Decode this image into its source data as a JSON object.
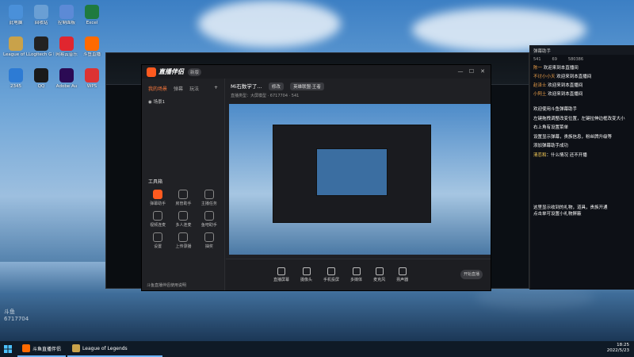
{
  "desktop": {
    "icons": [
      {
        "label": "此电脑",
        "color": "#4a90d9"
      },
      {
        "label": "回收站",
        "color": "#6a9fd4"
      },
      {
        "label": "控制面板",
        "color": "#5c8ad6"
      },
      {
        "label": "Excel",
        "color": "#1f7a3f"
      },
      {
        "label": "League of Legends",
        "color": "#c9a24a"
      },
      {
        "label": "Logitech G HUB",
        "color": "#222"
      },
      {
        "label": "网易云音乐",
        "color": "#e0262f"
      },
      {
        "label": "斗鱼直播",
        "color": "#ff6a00"
      },
      {
        "label": "2345",
        "color": "#2d7bd4"
      },
      {
        "label": "QQ",
        "color": "#1a1a1a"
      },
      {
        "label": "Adobe Au",
        "color": "#2b0a54"
      },
      {
        "label": "WPS",
        "color": "#d33"
      }
    ]
  },
  "live_watermark": {
    "line1": "斗鱼",
    "line2": "6717704"
  },
  "app": {
    "name": "直播伴侣",
    "version_tag": "新版",
    "tabs": [
      "我的场景",
      "弹幕",
      "玩法"
    ],
    "scene": "场景1",
    "tools_title": "工具箱",
    "tools": [
      {
        "label": "弹幕助手",
        "hot": true
      },
      {
        "label": "房管助手",
        "hot": false
      },
      {
        "label": "主播任务",
        "hot": false
      },
      {
        "label": "视频连麦",
        "hot": false
      },
      {
        "label": "多人连麦",
        "hot": false
      },
      {
        "label": "鱼吧助手",
        "hot": false
      },
      {
        "label": "设置",
        "hot": false
      },
      {
        "label": "上传录播",
        "hot": false
      },
      {
        "label": "抽奖",
        "hot": false
      }
    ],
    "help_text": "斗鱼直播伴侣使用说明",
    "stream_title": "Mi石数学了...",
    "edit_button": "修改",
    "category_button": "英雄联盟·王者",
    "stream_meta": "直播类型：大屏模型 · 6717704 · 541",
    "bottom_tools": [
      "直播屏幕",
      "摄像头",
      "手机投屏",
      "多媒体",
      "麦克风",
      "扬声器"
    ],
    "start_button": "开始直播"
  },
  "danmaku": {
    "title": "弹幕助手",
    "stats": [
      "541",
      "69",
      "580386"
    ],
    "messages": [
      {
        "user": "陈一",
        "text": "欢迎来到本直播间"
      },
      {
        "user": "不讨小小天",
        "text": "欢迎来到本直播间"
      },
      {
        "user": "赵泽士",
        "text": "欢迎来到本直播间"
      },
      {
        "user": "小阿土",
        "text": "欢迎来到本直播间"
      }
    ],
    "notice": "欢迎使用斗鱼弹幕助手",
    "notice_lines": [
      "左键拖拽调整改变位置，左键拉伸边框改变大小",
      "右上角有设置菜单",
      "设置显示弹幕，贵族信息，粉丝牌升级等",
      "添加弹幕助手成功"
    ],
    "highlight_user": "清恋和",
    "highlight_text": "什么情况 还不开播",
    "bottom_notice": [
      "这里显示收到的礼物，道具，贵族开通",
      "点击单可设置小礼物屏蔽"
    ]
  },
  "taskbar": {
    "items": [
      "斗鱼直播伴侣",
      "League of Legends"
    ],
    "time": "18:25",
    "date": "2022/5/23"
  }
}
